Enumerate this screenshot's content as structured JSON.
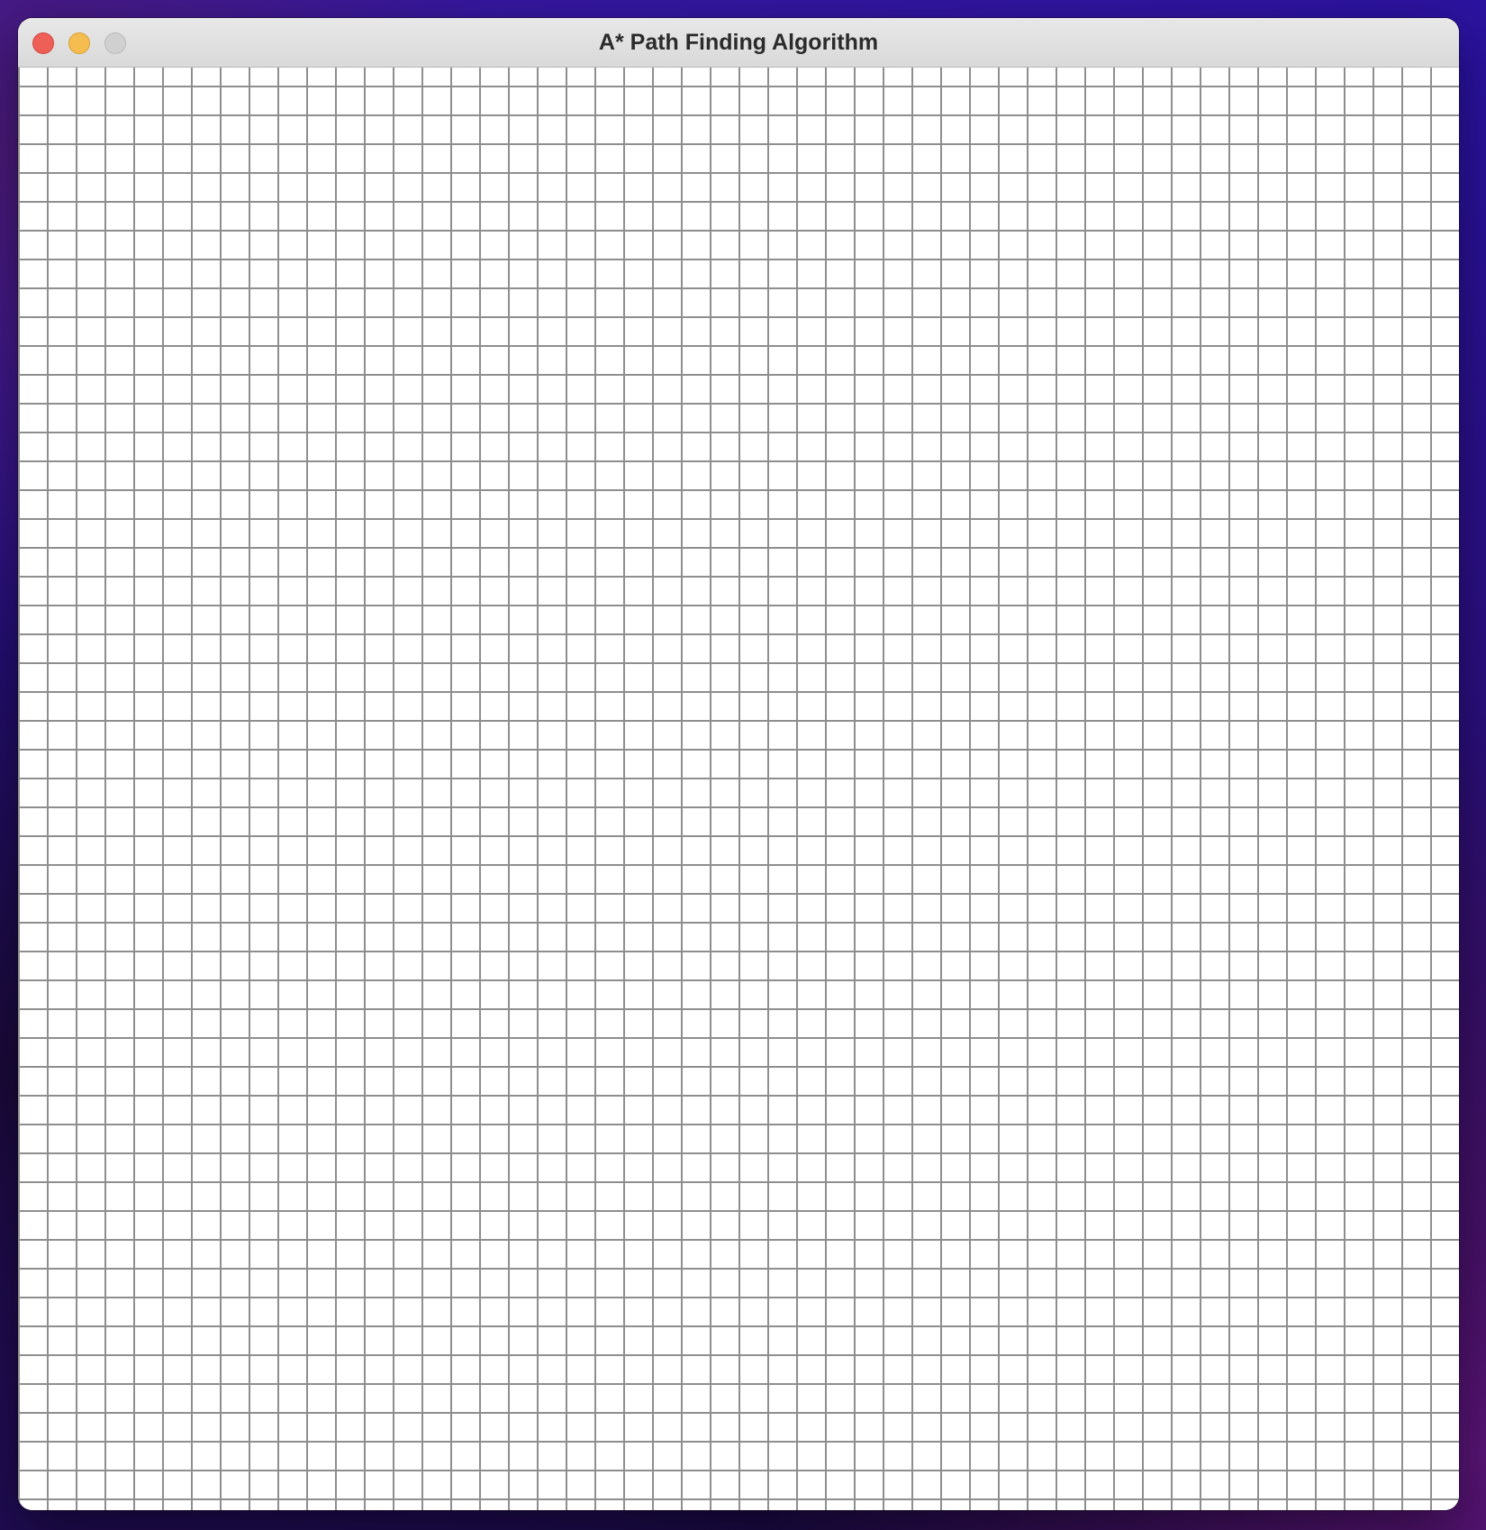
{
  "window": {
    "title": "A* Path Finding Algorithm",
    "buttons": {
      "close": "close-icon",
      "minimize": "minimize-icon",
      "zoom": "zoom-icon"
    },
    "colors": {
      "close": "#ee5f57",
      "minimize": "#f5bd4f",
      "zoom": "#d0d0d0",
      "grid_line": "#8e8e8e",
      "cell": "#ffffff"
    }
  },
  "grid": {
    "state": "empty"
  }
}
